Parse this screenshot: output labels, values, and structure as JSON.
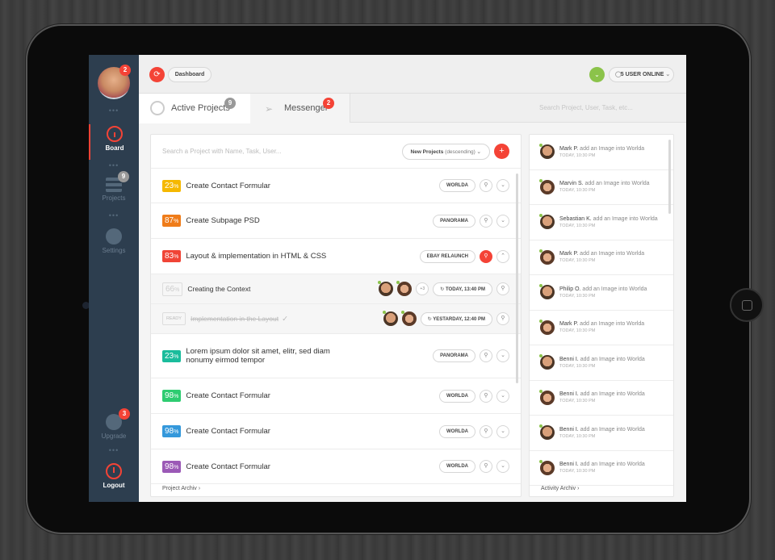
{
  "sidebar": {
    "avatar_badge": "2",
    "items": [
      {
        "label": "Board"
      },
      {
        "label": "Projects",
        "badge": "9"
      },
      {
        "label": "Settings"
      },
      {
        "label": "Upgrade",
        "badge": "3"
      },
      {
        "label": "Logout"
      }
    ]
  },
  "header": {
    "breadcrumb": "Dashboard",
    "online": "5 USER ONLINE"
  },
  "tabs": [
    {
      "label": "Active Projects",
      "badge": "9"
    },
    {
      "label": "Messenger",
      "badge": "2"
    }
  ],
  "global_search": {
    "placeholder": "Search Project, User, Task, etc..."
  },
  "projects": {
    "search_placeholder": "Search a Project with Name, Task, User...",
    "sort_label": "New Projects",
    "sort_suffix": "(descending)",
    "rows": [
      {
        "pct": "23",
        "color": "#f5b800",
        "title": "Create Contact Formular",
        "tag": "WORLDA"
      },
      {
        "pct": "87",
        "color": "#ef7c1a",
        "title": "Create Subpage PSD",
        "tag": "PANORAMA"
      },
      {
        "pct": "83",
        "color": "#f04436",
        "title": "Layout & implementation in HTML & CSS",
        "tag": "EBAY RELAUNCH"
      },
      {
        "pct": "23",
        "color": "#1abc9c",
        "title": "Lorem ipsum dolor sit amet, elitr, sed diam",
        "title2": "nonumy eirmod tempor",
        "tag": "PANORAMA"
      },
      {
        "pct": "98",
        "color": "#2ecc71",
        "title": "Create Contact Formular",
        "tag": "WORLDA"
      },
      {
        "pct": "98",
        "color": "#3498db",
        "title": "Create Contact Formular",
        "tag": "WORLDA"
      },
      {
        "pct": "98",
        "color": "#9b59b6",
        "title": "Create Contact Formular",
        "tag": "WORLDA"
      }
    ],
    "subtasks": [
      {
        "pct": "66",
        "title": "Creating the Context",
        "more": "+3",
        "time": "TODAY, 13:40 PM"
      },
      {
        "status": "READY",
        "title": "Implementation in the Layout",
        "time": "YESTARDAY, 12:40 PM"
      }
    ],
    "footer": "Project Archiv"
  },
  "activity": {
    "items": [
      {
        "name": "Mark P.",
        "text": "add an Image into Worlda",
        "time": "TODAY, 10:30 PM"
      },
      {
        "name": "Marvin S.",
        "text": "add an Image into Worlda",
        "time": "TODAY, 10:30 PM"
      },
      {
        "name": "Sebastian K.",
        "text": "add an Image into Worlda",
        "time": "TODAY, 10:30 PM"
      },
      {
        "name": "Mark P.",
        "text": "add an Image into Worlda",
        "time": "TODAY, 10:30 PM"
      },
      {
        "name": "Philip O.",
        "text": "add an Image into Worlda",
        "time": "TODAY, 10:30 PM"
      },
      {
        "name": "Mark P.",
        "text": "add an Image into Worlda",
        "time": "TODAY, 10:30 PM"
      },
      {
        "name": "Benni I.",
        "text": "add an Image into Worlda",
        "time": "TODAY, 10:30 PM"
      },
      {
        "name": "Benni I.",
        "text": "add an Image into Worlda",
        "time": "TODAY, 10:30 PM"
      },
      {
        "name": "Benni I.",
        "text": "add an Image into Worlda",
        "time": "TODAY, 10:30 PM"
      },
      {
        "name": "Benni I.",
        "text": "add an Image into Worlda",
        "time": "TODAY, 10:30 PM"
      }
    ],
    "footer": "Activity Archiv"
  },
  "colors": {
    "accent": "#f44336",
    "sidebar": "#2d3e4f",
    "online": "#8bc34a"
  }
}
